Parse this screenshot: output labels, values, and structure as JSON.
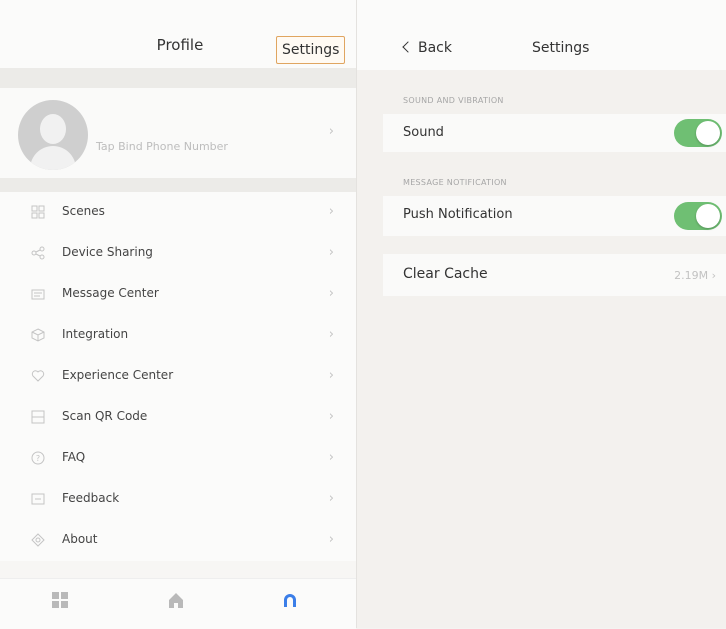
{
  "left": {
    "header": {
      "title": "Profile",
      "settings_label": "Settings"
    },
    "profile": {
      "phone_text": "Tap Bind Phone Number"
    },
    "menu": [
      {
        "label": "Scenes",
        "icon": "grid-icon"
      },
      {
        "label": "Device Sharing",
        "icon": "share-icon"
      },
      {
        "label": "Message Center",
        "icon": "message-icon"
      },
      {
        "label": "Integration",
        "icon": "cube-icon"
      },
      {
        "label": "Experience Center",
        "icon": "heart-icon"
      },
      {
        "label": "Scan QR Code",
        "icon": "scan-icon"
      },
      {
        "label": "FAQ",
        "icon": "question-icon"
      },
      {
        "label": "Feedback",
        "icon": "feedback-icon"
      },
      {
        "label": "About",
        "icon": "info-icon"
      }
    ],
    "tabbar": {
      "tabs": [
        {
          "icon": "devices-grid-icon",
          "active": false
        },
        {
          "icon": "home-icon",
          "active": false
        },
        {
          "icon": "profile-icon",
          "active": true
        }
      ]
    }
  },
  "right": {
    "header": {
      "back_label": "Back",
      "title": "Settings"
    },
    "sections": [
      {
        "label": "SOUND AND VIBRATION",
        "row_label": "Sound",
        "toggle_on": true
      },
      {
        "label": "MESSAGE NOTIFICATION",
        "row_label": "Push Notification",
        "toggle_on": true
      }
    ],
    "cache": {
      "label": "Clear Cache",
      "value": "2.19M"
    }
  },
  "colors": {
    "toggle_on": "#6fbf73",
    "accent": "#3b7ee8",
    "settings_border": "#e0a560"
  }
}
